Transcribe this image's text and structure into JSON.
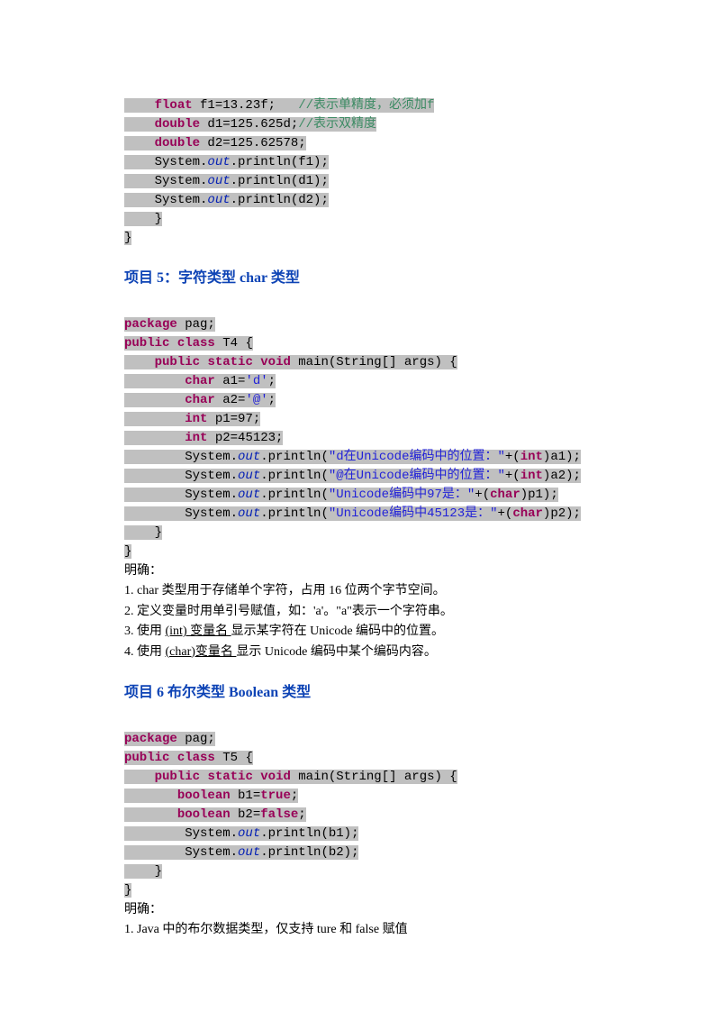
{
  "codeA": {
    "l1a": "float",
    "l1b": " f1=13.23f;   ",
    "l1c": "//表示单精度，必须加f",
    "l2a": "double",
    "l2b": " d1=125.625d;",
    "l2c": "//表示双精度",
    "l3a": "double",
    "l3b": " d2=125.62578;",
    "l4a": "System.",
    "l4b": "out",
    "l4c": ".println(f1);",
    "l5a": "System.",
    "l5b": "out",
    "l5c": ".println(d1);",
    "l6a": "System.",
    "l6b": "out",
    "l6c": ".println(d2);",
    "l7": "}",
    "l8": "}"
  },
  "head5": "项目 5：字符类型 char 类型",
  "codeB": {
    "l1a": "package",
    "l1b": " pag;",
    "l2a": "public",
    "l2b": " ",
    "l2c": "class",
    "l2d": " T4 {",
    "l3a": "public",
    "l3b": " ",
    "l3c": "static",
    "l3d": " ",
    "l3e": "void",
    "l3f": " main(String[] args) {",
    "l4a": "char",
    "l4b": " a1=",
    "l4c": "'d'",
    "l4d": ";",
    "l5a": "char",
    "l5b": " a2=",
    "l5c": "'@'",
    "l5d": ";",
    "l6a": "int",
    "l6b": " p1=97;",
    "l7a": "int",
    "l7b": " p2=45123;",
    "l8a": "System.",
    "l8b": "out",
    "l8c": ".println(",
    "l8d": "\"d在Unicode编码中的位置：\"",
    "l8e": "+(",
    "l8f": "int",
    "l8g": ")a1);",
    "l9a": "System.",
    "l9b": "out",
    "l9c": ".println(",
    "l9d": "\"@在Unicode编码中的位置：\"",
    "l9e": "+(",
    "l9f": "int",
    "l9g": ")a2);",
    "l10a": "System.",
    "l10b": "out",
    "l10c": ".println(",
    "l10d": "\"Unicode编码中97是：\"",
    "l10e": "+(",
    "l10f": "char",
    "l10g": ")p1);",
    "l11a": "System.",
    "l11b": "out",
    "l11c": ".println(",
    "l11d": "\"Unicode编码中45123是：\"",
    "l11e": "+(",
    "l11f": "char",
    "l11g": ")p2);",
    "l12": "}",
    "l13": "}"
  },
  "noteB": {
    "t": "明确：",
    "n1": "1.  char 类型用于存储单个字符，占用 16 位两个字节空间。",
    "n2": "2.  定义变量时用单引号赋值，如：'a'。\"a\"表示一个字符串。",
    "n3a": "3.  使用 ",
    "n3b": " (int) 变量名 ",
    "n3c": " 显示某字符在 Unicode 编码中的位置。",
    "n4a": "4.  使用 ",
    "n4b": " (char)变量名 ",
    "n4c": "显示 Unicode 编码中某个编码内容。"
  },
  "head6": "项目 6 布尔类型   Boolean 类型",
  "codeC": {
    "l1a": "package",
    "l1b": " pag;",
    "l2a": "public",
    "l2b": " ",
    "l2c": "class",
    "l2d": " T5 {",
    "l3a": "public",
    "l3b": " ",
    "l3c": "static",
    "l3d": " ",
    "l3e": "void",
    "l3f": " main(String[] args) {",
    "l4a": "boolean",
    "l4b": " b1=",
    "l4c": "true",
    "l4d": ";",
    "l5a": "boolean",
    "l5b": " b2=",
    "l5c": "false",
    "l5d": ";",
    "l6a": " System.",
    "l6b": "out",
    "l6c": ".println(b1);",
    "l7a": " System.",
    "l7b": "out",
    "l7c": ".println(b2);",
    "l8": "}",
    "l9": "}"
  },
  "noteC": {
    "t": "明确：",
    "n1": "1.  Java 中的布尔数据类型，仅支持 ture 和 false 赋值"
  }
}
